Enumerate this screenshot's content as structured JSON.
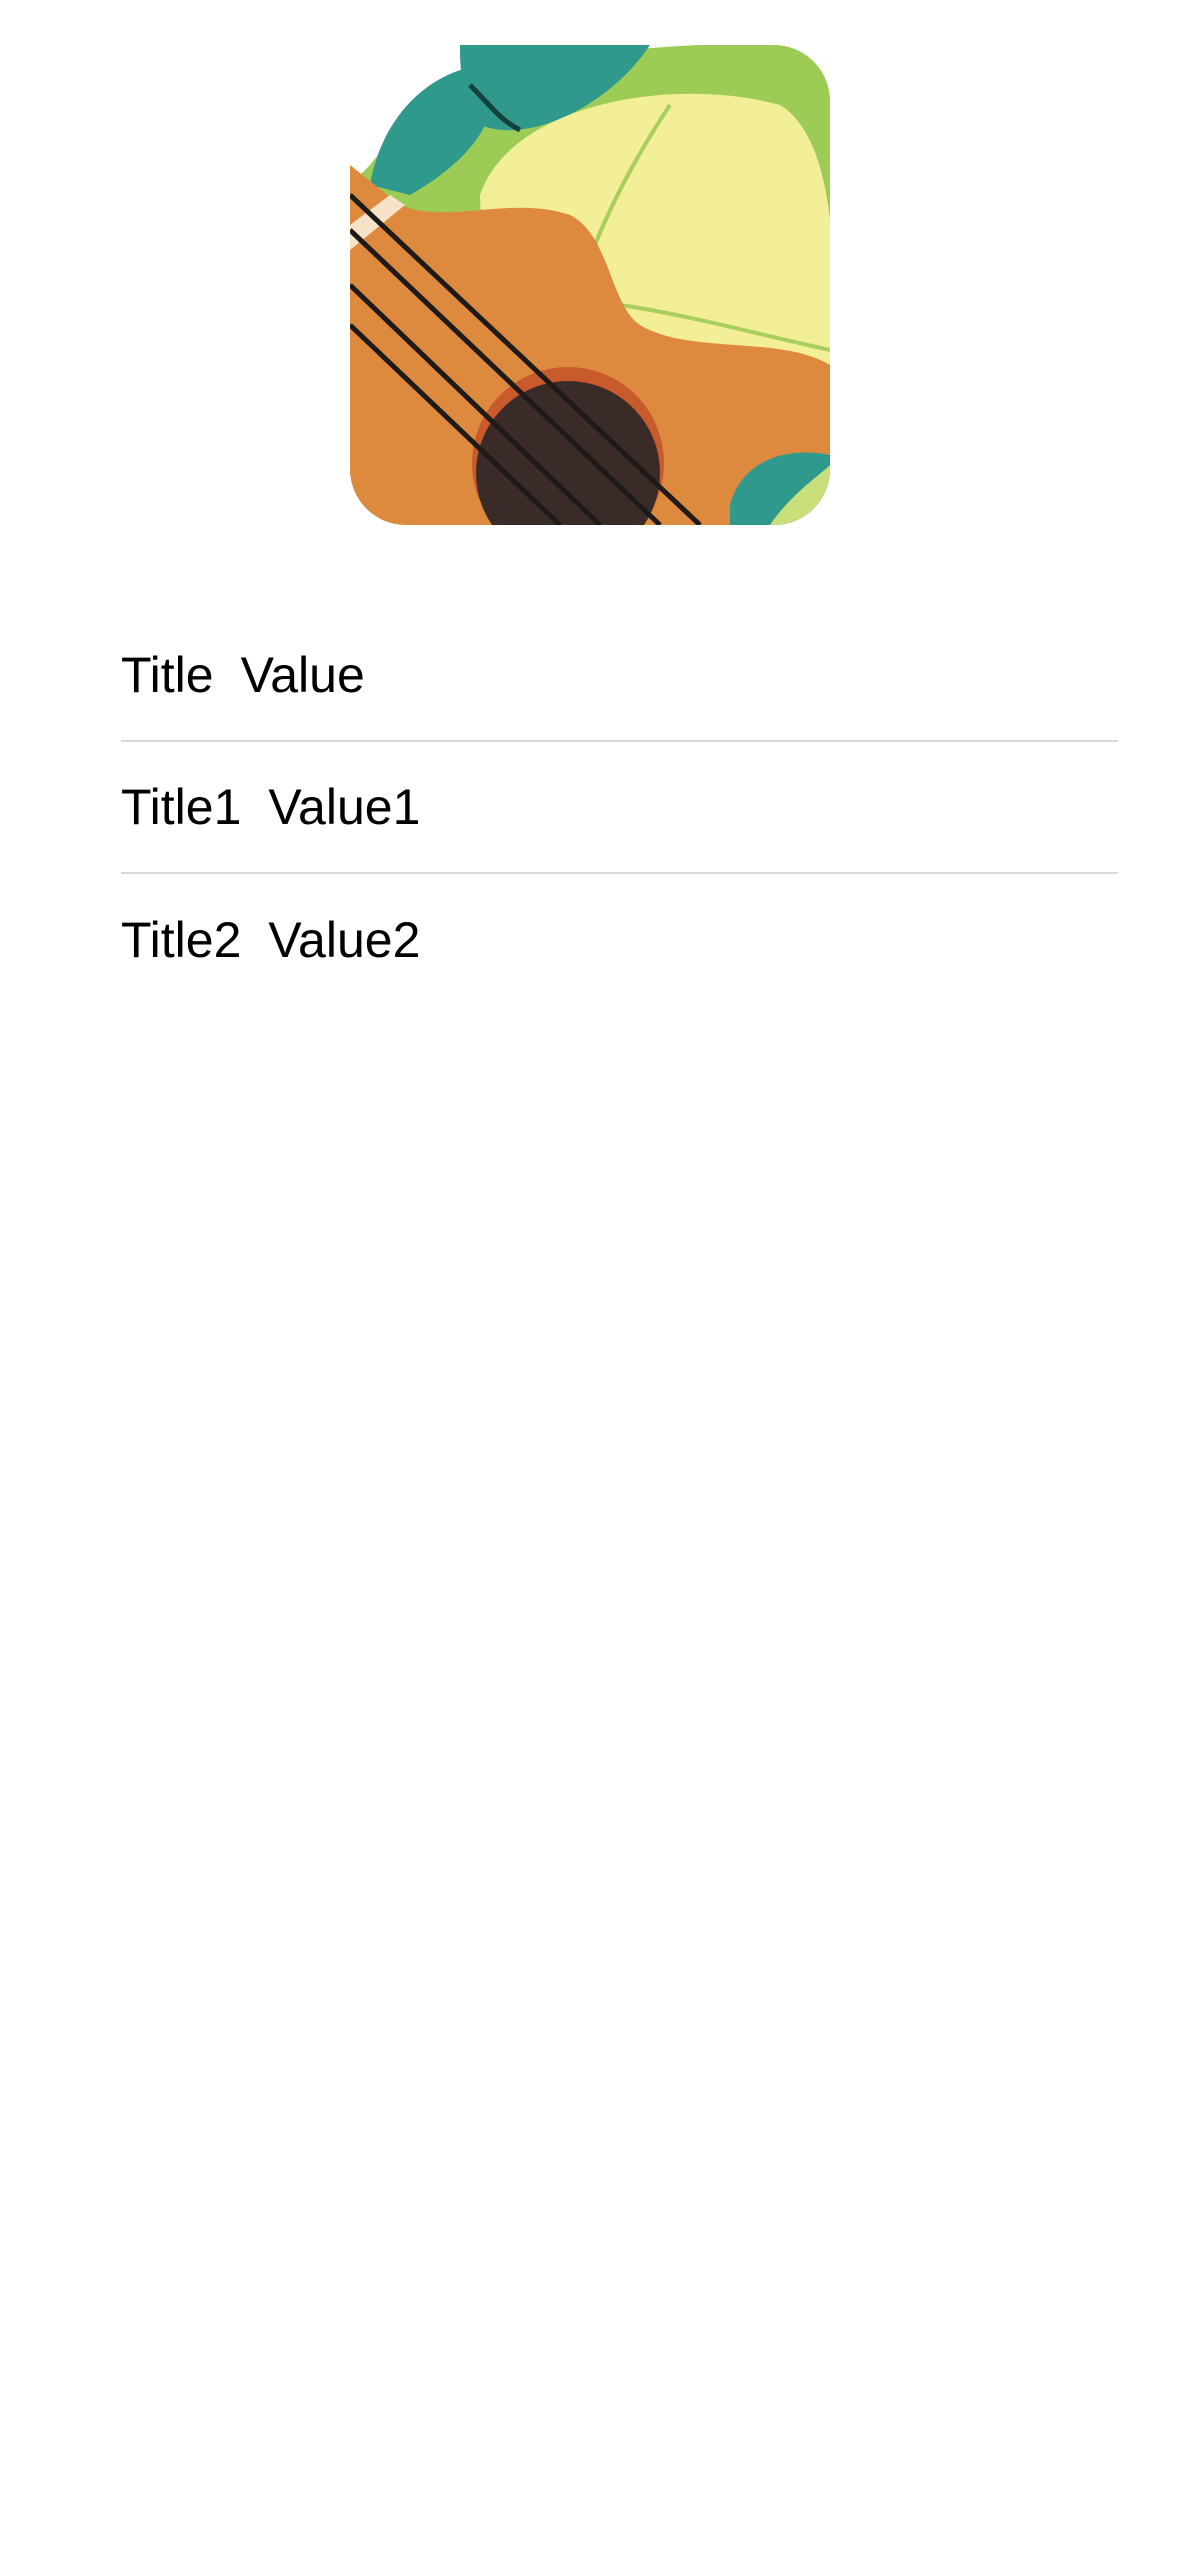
{
  "album_art": {
    "icon": "ukulele-artwork",
    "colors": {
      "teal": "#2f9a8c",
      "green": "#9ccc55",
      "yellow": "#f3ee98",
      "orange": "#dd8a3f",
      "soundhole": "#3a2b28",
      "strings": "#1e1a18"
    }
  },
  "items": [
    {
      "title": "Title",
      "value": "Value"
    },
    {
      "title": "Title1",
      "value": "Value1"
    },
    {
      "title": "Title2",
      "value": "Value2"
    }
  ]
}
